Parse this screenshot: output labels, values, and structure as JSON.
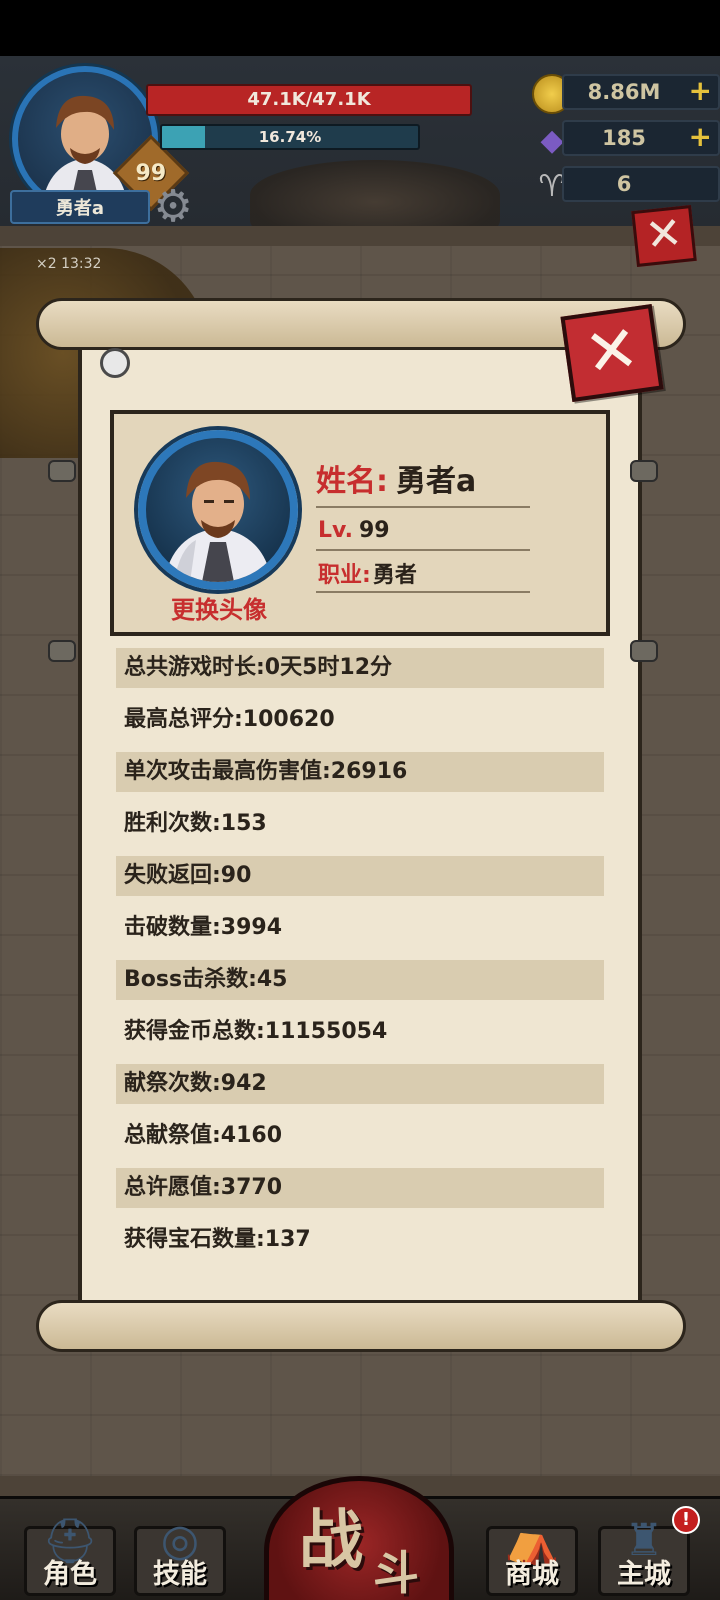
{
  "hud": {
    "player_name": "勇者a",
    "level": "99",
    "hp_text": "47.1K/47.1K",
    "xp_percent_text": "16.74%",
    "xp_progress": 0.1674,
    "resources": [
      {
        "name": "gold",
        "value": "8.86M",
        "plus": "+"
      },
      {
        "name": "gem",
        "value": "185",
        "plus": "+"
      },
      {
        "name": "horn",
        "value": "6"
      }
    ],
    "timer_text": "×2 13:32"
  },
  "profile": {
    "name_label": "姓名:",
    "name_value": "勇者a",
    "level_label": "Lv.",
    "level_value": "99",
    "job_label": "职业:",
    "job_value": "勇者",
    "change_avatar_label": "更换头像",
    "close_icon": "✕"
  },
  "stats": [
    "总共游戏时长:0天5时12分",
    "最高总评分:100620",
    "单次攻击最高伤害值:26916",
    "胜利次数:153",
    "失败返回:90",
    "击破数量:3994",
    "Boss击杀数:45",
    "获得金币总数:11155054",
    "献祭次数:942",
    "总献祭值:4160",
    "总许愿值:3770",
    "获得宝石数量:137"
  ],
  "nav": {
    "role": "角色",
    "skill": "技能",
    "battle_1": "战",
    "battle_2": "斗",
    "shop": "商城",
    "city": "主城",
    "city_alert": "!"
  },
  "colors": {
    "accent_red": "#c72e2e",
    "hp_red": "#b82525",
    "xp_teal": "#3ca2b4",
    "parchment": "#efe6d2",
    "frame_blue": "#2d78ba"
  }
}
